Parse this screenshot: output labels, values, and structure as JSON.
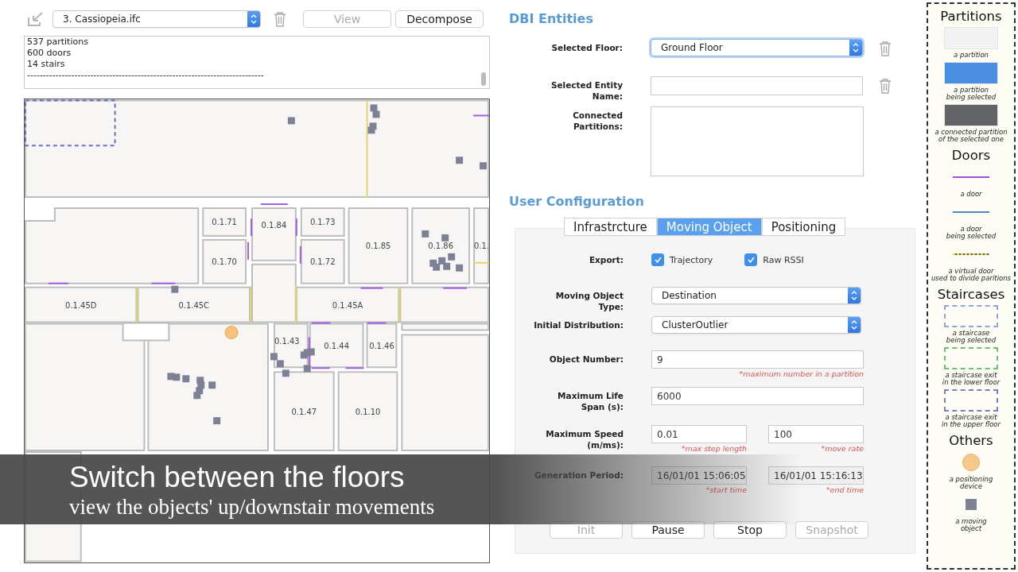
{
  "toolbar": {
    "file": "3. Cassiopeia.ifc",
    "buttons": [
      {
        "label": "View",
        "disabled": true
      },
      {
        "label": "Decompose",
        "disabled": false
      }
    ]
  },
  "log": {
    "lines": [
      "537 partitions",
      "600 doors",
      "14 stairs",
      "---------------------------------------------------------------------------"
    ]
  },
  "floor_plan": {
    "rooms": [
      "0.1.71",
      "0.1.70",
      "0.1.84",
      "0.1.73",
      "0.1.72",
      "0.1.85",
      "0.1.86",
      "0.1.",
      "0.1.45D",
      "0.1.45C",
      "0.1.45A",
      "0.1.43",
      "0.1.44",
      "0.1.46",
      "0.1.47",
      "0.1.10"
    ]
  },
  "caption": {
    "title": "Switch between the floors",
    "subtitle": "view the objects' up/downstair movements"
  },
  "dbi": {
    "title": "DBI Entities",
    "fields": [
      {
        "kind": "select",
        "label": "Selected Floor:",
        "value": "Ground Floor",
        "focused": true,
        "deletable": true
      },
      {
        "kind": "text",
        "label": "Selected Entity\nName:",
        "deletable": true
      },
      {
        "kind": "area",
        "label": "Connected\nPartitions:"
      }
    ]
  },
  "config": {
    "title": "User Configuration",
    "tabs": [
      {
        "label": "Infrastrcture",
        "selected": false
      },
      {
        "label": "Moving Object",
        "selected": true
      },
      {
        "label": "Positioning",
        "selected": false
      }
    ],
    "rows": [
      {
        "kind": "checks",
        "label": "Export:",
        "options": [
          {
            "label": "Trajectory",
            "checked": true
          },
          {
            "label": "Raw RSSI",
            "checked": true
          }
        ]
      },
      {
        "kind": "select",
        "label": "Moving Object\nType:",
        "value": "Destination"
      },
      {
        "kind": "select",
        "label": "Initial Distribution:",
        "value": "ClusterOutlier"
      },
      {
        "kind": "text",
        "label": "Object Number:",
        "value": "9",
        "note": "*maximum number in a partition"
      },
      {
        "kind": "text",
        "label": "Maximum Life\nSpan (s):",
        "value": "6000"
      },
      {
        "kind": "pair",
        "label": "Maximum Speed\n(m/ms):",
        "fields": [
          {
            "value": "0.01",
            "note": "*max step length",
            "disabled": false
          },
          {
            "value": "100",
            "note": "*move rate",
            "disabled": false
          }
        ]
      },
      {
        "kind": "pair",
        "label": "Generation Period:",
        "fields": [
          {
            "value": "16/01/01 15:06:05",
            "note": "*start time",
            "disabled": true
          },
          {
            "value": "16/01/01 15:16:13",
            "note": "*end time",
            "disabled": true
          }
        ]
      }
    ],
    "buttons": [
      {
        "label": "Init",
        "disabled": true
      },
      {
        "label": "Pause",
        "disabled": false
      },
      {
        "label": "Stop",
        "disabled": false
      },
      {
        "label": "Snapshot",
        "disabled": true
      }
    ]
  },
  "legend": {
    "sections": [
      {
        "title": "Partitions",
        "items": [
          {
            "kind": "swatch",
            "color": "#f2f2f2",
            "label": "a partition"
          },
          {
            "kind": "swatch",
            "color": "#4a90e2",
            "label": "a partition\nbeing selected"
          },
          {
            "kind": "swatch",
            "color": "#636466",
            "label": "a connected partition\nof the selected one"
          }
        ]
      },
      {
        "title": "Doors",
        "items": [
          {
            "kind": "line",
            "color": "#9b4fe0",
            "label": "a door"
          },
          {
            "kind": "line",
            "color": "#4a8ac0",
            "label": "a door\nbeing selected"
          },
          {
            "kind": "virtual",
            "color": "#d8cf50",
            "label": "a virtual door\nused to divide paritions"
          }
        ]
      },
      {
        "title": "Staircases",
        "items": [
          {
            "kind": "dashed",
            "color": "#8fa6d8",
            "label": "a staircase\nbeing selected"
          },
          {
            "kind": "dashed",
            "color": "#6cc070",
            "label": "a staircase exit\nin the lower floor"
          },
          {
            "kind": "dashed",
            "color": "#7a7fc8",
            "label": "a staircase exit\nin the upper floor"
          }
        ]
      },
      {
        "title": "Others",
        "items": [
          {
            "kind": "circle",
            "color": "#f6c98a",
            "label": "a positioning\ndevice"
          },
          {
            "kind": "square",
            "color": "#7d8196",
            "label": "a moving\nobject"
          }
        ]
      }
    ]
  }
}
